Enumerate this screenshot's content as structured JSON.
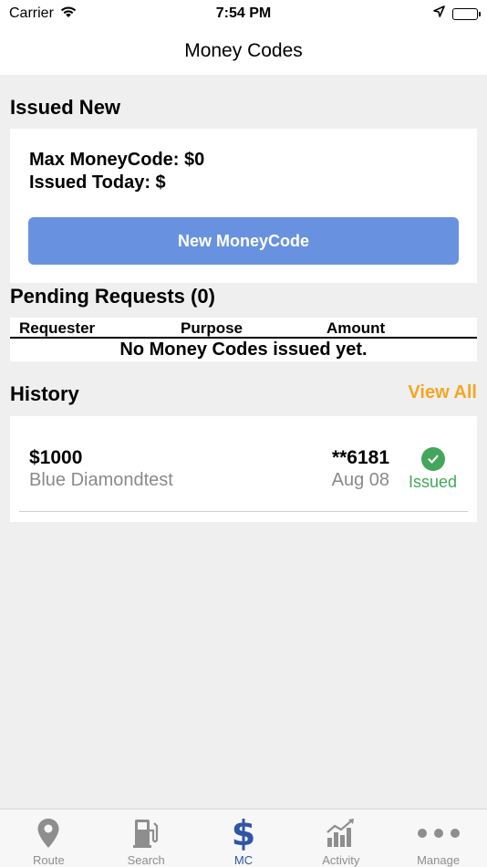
{
  "status_bar": {
    "carrier": "Carrier",
    "time": "7:54 PM"
  },
  "nav": {
    "title": "Money Codes"
  },
  "issued_new": {
    "header": "Issued New",
    "max_money_code": "Max MoneyCode: $0",
    "issued_today": "Issued Today: $",
    "button_label": "New MoneyCode"
  },
  "pending": {
    "header": "Pending Requests (0)",
    "columns": [
      "Requester",
      "Purpose",
      "Amount"
    ],
    "empty_message": "No Money Codes issued yet."
  },
  "history": {
    "header": "History",
    "view_all_label": "View All",
    "items": [
      {
        "amount": "$1000",
        "name": "Blue Diamondtest",
        "code": "**6181",
        "date": "Aug 08",
        "status": "Issued"
      }
    ]
  },
  "tab_bar": {
    "tabs": [
      {
        "label": "Route",
        "icon": "location-pin-icon"
      },
      {
        "label": "Search",
        "icon": "fuel-pump-icon"
      },
      {
        "label": "MC",
        "icon": "dollar-icon",
        "active": true
      },
      {
        "label": "Activity",
        "icon": "bar-chart-icon"
      },
      {
        "label": "Manage",
        "icon": "more-icon"
      }
    ]
  },
  "colors": {
    "accent_blue": "#6891e0",
    "active_tab": "#2f56a5",
    "view_all": "#f5a623",
    "issued_green": "#43a65a"
  }
}
